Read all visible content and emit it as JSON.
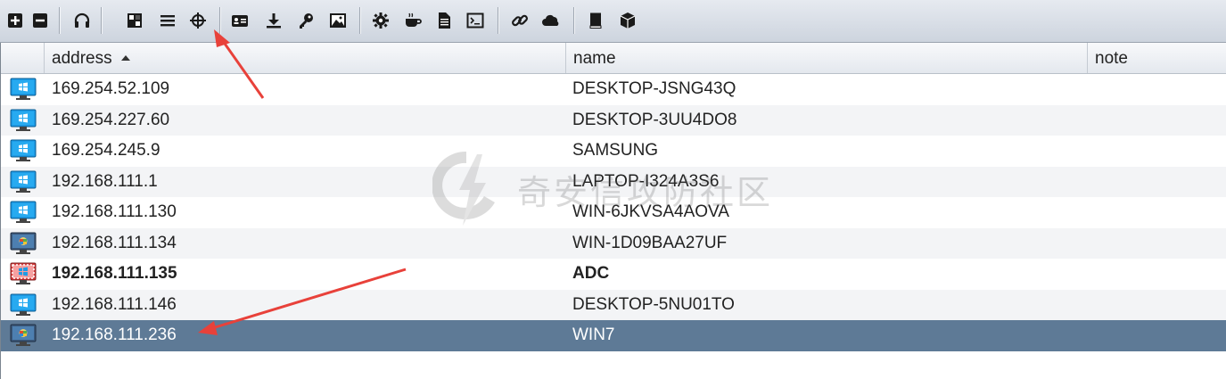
{
  "toolbar": {
    "buttons": [
      {
        "icon": "plus-square-icon"
      },
      {
        "icon": "minus-square-icon"
      },
      {
        "icon": "headphones-icon"
      },
      {
        "icon": "pivot-graph-icon"
      },
      {
        "icon": "list-icon"
      },
      {
        "icon": "crosshair-icon"
      },
      {
        "icon": "credentials-card-icon"
      },
      {
        "icon": "download-icon"
      },
      {
        "icon": "key-icon"
      },
      {
        "icon": "screenshot-image-icon"
      },
      {
        "icon": "gear-icon"
      },
      {
        "icon": "coffee-cup-icon"
      },
      {
        "icon": "document-icon"
      },
      {
        "icon": "terminal-icon"
      },
      {
        "icon": "link-icon"
      },
      {
        "icon": "cloud-icon"
      },
      {
        "icon": "book-icon"
      },
      {
        "icon": "cube-icon"
      }
    ]
  },
  "table": {
    "columns": {
      "address": "address",
      "name": "name",
      "note": "note"
    },
    "sort": {
      "column": "address",
      "direction": "ascending"
    },
    "rows": [
      {
        "address": "169.254.52.109",
        "name": "DESKTOP-JSNG43Q",
        "note": "",
        "icon": "windows-monitor-icon"
      },
      {
        "address": "169.254.227.60",
        "name": "DESKTOP-3UU4DO8",
        "note": "",
        "icon": "windows-monitor-icon"
      },
      {
        "address": "169.254.245.9",
        "name": "SAMSUNG",
        "note": "",
        "icon": "windows-monitor-icon"
      },
      {
        "address": "192.168.111.1",
        "name": "LAPTOP-I324A3S6",
        "note": "",
        "icon": "windows-monitor-icon"
      },
      {
        "address": "192.168.111.130",
        "name": "WIN-6JKVSA4AOVA",
        "note": "",
        "icon": "windows-monitor-icon"
      },
      {
        "address": "192.168.111.134",
        "name": "WIN-1D09BAA27UF",
        "note": "",
        "icon": "windows7-monitor-icon"
      },
      {
        "address": "192.168.111.135",
        "name": "ADC",
        "note": "",
        "icon": "compromised-windows-monitor-icon"
      },
      {
        "address": "192.168.111.146",
        "name": "DESKTOP-5NU01TO",
        "note": "",
        "icon": "windows-monitor-icon"
      },
      {
        "address": "192.168.111.236",
        "name": "WIN7",
        "note": "",
        "icon": "windows7-monitor-icon"
      }
    ],
    "selected_row": 8,
    "bold_row": 6
  },
  "watermark": {
    "text": "奇安信攻防社区"
  },
  "colors": {
    "selection": "#5e7a96",
    "annotation_arrow": "#e8413a",
    "windows_blue": "#1e9be6"
  }
}
